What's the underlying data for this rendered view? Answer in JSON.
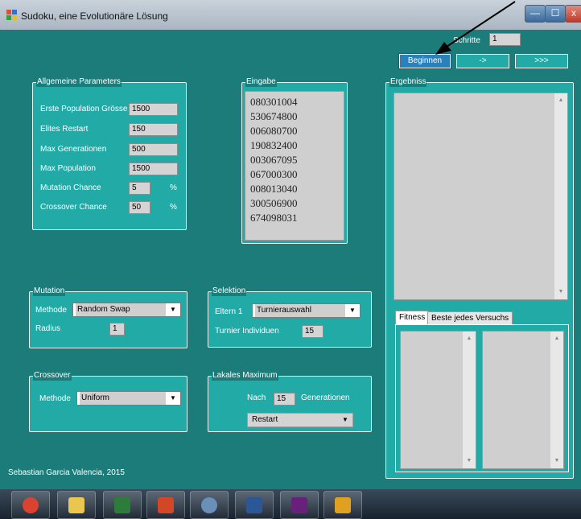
{
  "window": {
    "title": "Sudoku, eine Evolutionäre Lösung",
    "min_glyph": "—",
    "max_glyph": "☐",
    "close_glyph": "x"
  },
  "top": {
    "schritte_label": "Schritte",
    "schritte_value": "1",
    "beginnen_label": "Beginnen",
    "step_label": "->",
    "run_label": ">>>"
  },
  "allgemeine": {
    "title": "Allgemeine Parameters",
    "rows": [
      {
        "label": "Erste Population Grösse",
        "value": "1500",
        "unit": ""
      },
      {
        "label": "Elites Restart",
        "value": "150",
        "unit": ""
      },
      {
        "label": "Max Generationen",
        "value": "500",
        "unit": ""
      },
      {
        "label": "Max Population",
        "value": "1500",
        "unit": ""
      },
      {
        "label": "Mutation Chance",
        "value": "5",
        "unit": "%"
      },
      {
        "label": "Crossover Chance",
        "value": "50",
        "unit": "%"
      }
    ]
  },
  "eingabe": {
    "title": "Eingabe",
    "lines": [
      "080301004",
      "530674800",
      "006080700",
      "190832400",
      "003067095",
      "067000300",
      "008013040",
      "300506900",
      "674098031"
    ]
  },
  "ergebniss": {
    "title": "Ergebniss",
    "tabs": [
      "Fitness",
      "Beste jedes Versuchs"
    ]
  },
  "mutation": {
    "title": "Mutation",
    "methode_label": "Methode",
    "methode_value": "Random Swap",
    "radius_label": "Radius",
    "radius_value": "1"
  },
  "selektion": {
    "title": "Selektion",
    "eltern_label": "Eltern 1",
    "eltern_value": "Turnierauswahl",
    "turnier_label": "Turnier Individuen",
    "turnier_value": "15"
  },
  "crossover": {
    "title": "Crossover",
    "methode_label": "Methode",
    "methode_value": "Uniform"
  },
  "lokal": {
    "title": "Lakales Maximum",
    "nach_label": "Nach",
    "nach_value": "15",
    "gen_label": "Generationen",
    "action_value": "Restart"
  },
  "footer": "Sebastian Garcia Valencia, 2015",
  "taskbar_apps": [
    {
      "icon": "chrome-icon",
      "color": "#d9432f"
    },
    {
      "icon": "file-explorer-icon",
      "color": "#e8c650"
    },
    {
      "icon": "excel-icon",
      "color": "#2d7d3a"
    },
    {
      "icon": "powerpoint-icon",
      "color": "#d24726"
    },
    {
      "icon": "network-icon",
      "color": "#6a8fb8"
    },
    {
      "icon": "word-icon",
      "color": "#2b5797"
    },
    {
      "icon": "visual-studio-icon",
      "color": "#68217a"
    },
    {
      "icon": "app-icon",
      "color": "#e0a020"
    }
  ]
}
